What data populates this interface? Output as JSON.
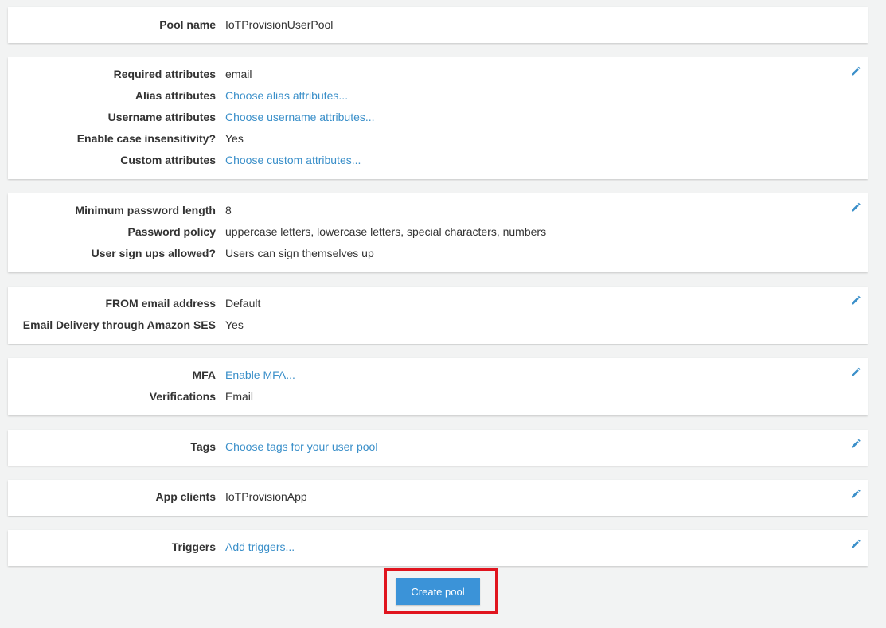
{
  "pool": {
    "label": "Pool name",
    "value": "IoTProvisionUserPool"
  },
  "attributes": {
    "required": {
      "label": "Required attributes",
      "value": "email"
    },
    "alias": {
      "label": "Alias attributes",
      "value": "Choose alias attributes..."
    },
    "username": {
      "label": "Username attributes",
      "value": "Choose username attributes..."
    },
    "case": {
      "label": "Enable case insensitivity?",
      "value": "Yes"
    },
    "custom": {
      "label": "Custom attributes",
      "value": "Choose custom attributes..."
    }
  },
  "policies": {
    "min_len": {
      "label": "Minimum password length",
      "value": "8"
    },
    "policy": {
      "label": "Password policy",
      "value": "uppercase letters, lowercase letters, special characters, numbers"
    },
    "signup": {
      "label": "User sign ups allowed?",
      "value": "Users can sign themselves up"
    }
  },
  "email": {
    "from": {
      "label": "FROM email address",
      "value": "Default"
    },
    "ses": {
      "label": "Email Delivery through Amazon SES",
      "value": "Yes"
    }
  },
  "mfa": {
    "mfa": {
      "label": "MFA",
      "value": "Enable MFA..."
    },
    "verifications": {
      "label": "Verifications",
      "value": "Email"
    }
  },
  "tags": {
    "label": "Tags",
    "value": "Choose tags for your user pool"
  },
  "app_clients": {
    "label": "App clients",
    "value": "IoTProvisionApp"
  },
  "triggers": {
    "label": "Triggers",
    "value": "Add triggers..."
  },
  "create_button": {
    "label": "Create pool"
  },
  "colors": {
    "link": "#3a8fc9",
    "button": "#3b93d8",
    "highlight": "#e0141e"
  }
}
